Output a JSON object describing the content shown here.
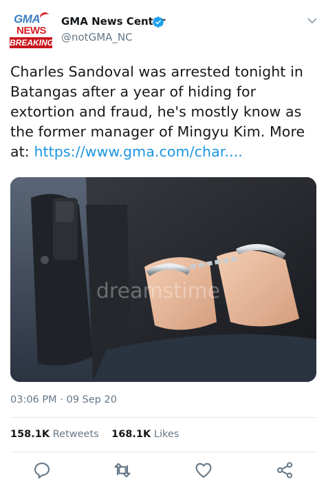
{
  "account": {
    "logo": {
      "line1": "GMA",
      "line2": "NEWS",
      "line3": "BREAKING"
    },
    "display_name": "GMA News Center",
    "handle": "@notGMA_NC",
    "verified": true
  },
  "tweet": {
    "text": "Charles Sandoval was arrested tonight in Batangas after a year of hiding for extortion and fraud, he's mostly know as the former manager of Mingyu Kim. More at: ",
    "link": "https://www.gma.com/char....",
    "image_watermark": "dreamstime",
    "timestamp": "03:06 PM · 09 Sep 20"
  },
  "stats": {
    "retweets_count": "158.1K",
    "retweets_label": "Retweets",
    "likes_count": "168.1K",
    "likes_label": "Likes"
  },
  "icons": {
    "verified": "verified-badge-icon",
    "menu": "chevron-down-icon",
    "reply": "reply-icon",
    "retweet": "retweet-icon",
    "like": "heart-icon",
    "share": "share-icon"
  },
  "colors": {
    "link": "#1b95e0",
    "secondary_text": "#657786",
    "verified": "#1da1f2",
    "breaking_red": "#c8161d"
  }
}
